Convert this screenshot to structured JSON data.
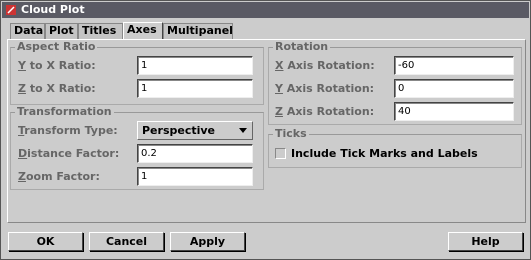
{
  "window": {
    "title": "Cloud Plot"
  },
  "tabs": [
    {
      "label": "Data",
      "selected": false
    },
    {
      "label": "Plot",
      "selected": false
    },
    {
      "label": "Titles",
      "selected": false
    },
    {
      "label": "Axes",
      "selected": true
    },
    {
      "label": "Multipanel",
      "selected": false
    }
  ],
  "aspect_ratio": {
    "title": "Aspect Ratio",
    "y_to_x_label_mnemonic": "Y",
    "y_to_x_label_rest": " to X Ratio:",
    "y_to_x_value": "1",
    "z_to_x_label_mnemonic": "Z",
    "z_to_x_label_rest": " to X Ratio:",
    "z_to_x_value": "1"
  },
  "transformation": {
    "title": "Transformation",
    "type_label_mnemonic": "T",
    "type_label_rest": "ransform Type:",
    "type_value": "Perspective",
    "distance_label_mnemonic": "D",
    "distance_label_rest": "istance Factor:",
    "distance_value": "0.2",
    "zoom_label_mnemonic": "Z",
    "zoom_label_rest": "oom Factor:",
    "zoom_value": "1"
  },
  "rotation": {
    "title": "Rotation",
    "x_label_mnemonic": "X",
    "x_label_rest": " Axis Rotation:",
    "x_value": "-60",
    "y_label_mnemonic": "Y",
    "y_label_rest": " Axis Rotation:",
    "y_value": "0",
    "z_label_mnemonic": "Z",
    "z_label_rest": " Axis Rotation:",
    "z_value": "40"
  },
  "ticks": {
    "title": "Ticks",
    "include_label": "Include Tick Marks and Labels",
    "include_checked": false
  },
  "buttons": {
    "ok": "OK",
    "cancel": "Cancel",
    "apply": "Apply",
    "help": "Help"
  },
  "colors": {
    "background": "#cccccc",
    "titlebar": "#5a5a64",
    "group_label": "#666666"
  },
  "icons": {
    "app": "splus-app-icon",
    "dropdown": "chevron-down-icon"
  }
}
